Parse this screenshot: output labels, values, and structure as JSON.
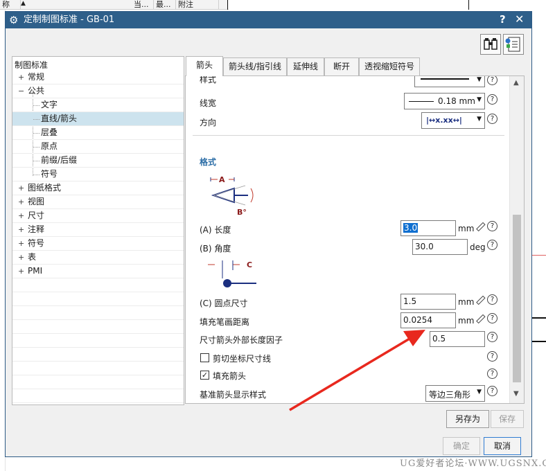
{
  "background": {
    "columns": [
      "称",
      "当...",
      "最...",
      "附注"
    ],
    "watermark": "UG爱好者论坛·WWW.UGSNX.COM"
  },
  "dialog": {
    "title": "定制制图标准 - GB-01",
    "help_glyph": "?",
    "close_glyph": "✕",
    "toolbar": [
      {
        "name": "binoculars-icon"
      },
      {
        "name": "info-panel-icon"
      }
    ]
  },
  "tree": {
    "root": "制图标准",
    "items": [
      {
        "label": "常规",
        "expander": "+"
      },
      {
        "label": "公共",
        "expander": "−"
      },
      {
        "label": "文字"
      },
      {
        "label": "直线/箭头",
        "selected": true
      },
      {
        "label": "层叠"
      },
      {
        "label": "原点"
      },
      {
        "label": "前缀/后缀"
      },
      {
        "label": "符号"
      },
      {
        "label": "图纸格式",
        "expander": "+"
      },
      {
        "label": "视图",
        "expander": "+"
      },
      {
        "label": "尺寸",
        "expander": "+"
      },
      {
        "label": "注释",
        "expander": "+"
      },
      {
        "label": "符号",
        "expander": "+"
      },
      {
        "label": "表",
        "expander": "+"
      },
      {
        "label": "PMI",
        "expander": "+"
      }
    ]
  },
  "tabs": [
    {
      "label": "箭头",
      "active": true
    },
    {
      "label": "箭头线/指引线"
    },
    {
      "label": "延伸线"
    },
    {
      "label": "断开"
    },
    {
      "label": "透视缩短符号"
    }
  ],
  "panel": {
    "style_label": "样式",
    "width_label": "线宽",
    "width_value": "0.18 mm",
    "direction_label": "方向",
    "direction_value": "|↔x.xx↔|",
    "section_title": "格式",
    "diagram_a": "A",
    "diagram_b": "B°",
    "length_label": "(A) 长度",
    "length_value": "3.0",
    "length_unit": "mm",
    "angle_label": "(B) 角度",
    "angle_value": "30.0",
    "angle_unit": "deg",
    "diagram_c": "C",
    "dot_label": "(C) 圆点尺寸",
    "dot_value": "1.5",
    "dot_unit": "mm",
    "fill_label": "填充笔画距离",
    "fill_value": "0.0254",
    "fill_unit": "mm",
    "factor_label": "尺寸箭头外部长度因子",
    "factor_value": "0.5",
    "clip_label": "剪切坐标尺寸线",
    "clip_checked": false,
    "fill_arrow_label": "填充箭头",
    "fill_arrow_checked": true,
    "datum_label": "基准箭头显示样式",
    "datum_value": "等边三角形"
  },
  "buttons": {
    "save_as": "另存为",
    "save": "保存",
    "ok": "确定",
    "cancel": "取消"
  },
  "colors": {
    "titlebar": "#2e5f8a",
    "selection": "#cde3ee",
    "section": "#2b6da6",
    "annotation_arrow": "#e8281e"
  }
}
